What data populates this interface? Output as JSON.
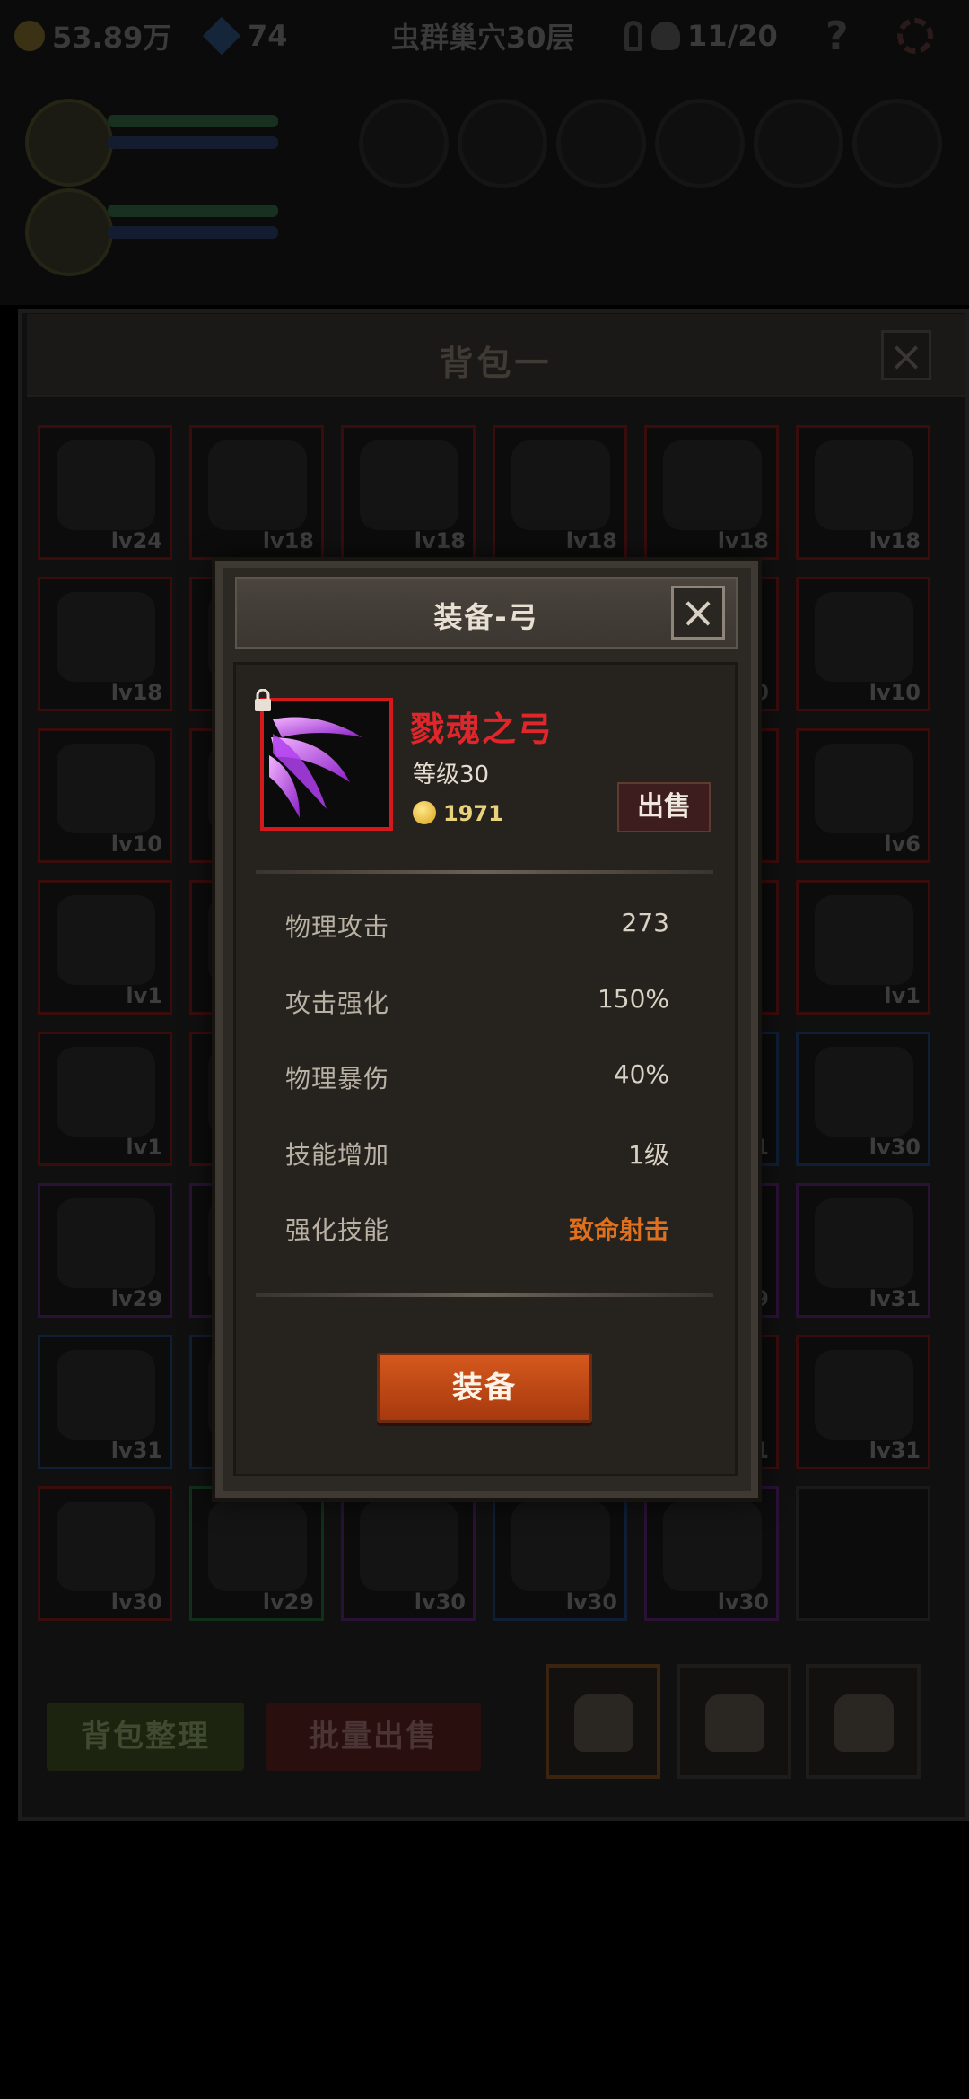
{
  "hud": {
    "gold": "53.89万",
    "gems": "74",
    "stage": "虫群巢穴30层",
    "lives": "11/20"
  },
  "backpack": {
    "title": "背包一",
    "items": [
      {
        "lv": "lv24",
        "rarity": "red"
      },
      {
        "lv": "lv18",
        "rarity": "red"
      },
      {
        "lv": "lv18",
        "rarity": "red"
      },
      {
        "lv": "lv18",
        "rarity": "red"
      },
      {
        "lv": "lv18",
        "rarity": "red"
      },
      {
        "lv": "lv18",
        "rarity": "red"
      },
      {
        "lv": "lv18",
        "rarity": "red"
      },
      {
        "lv": "",
        "rarity": "red"
      },
      {
        "lv": "",
        "rarity": "red"
      },
      {
        "lv": "",
        "rarity": "red"
      },
      {
        "lv": "lv10",
        "rarity": "red"
      },
      {
        "lv": "lv10",
        "rarity": "red"
      },
      {
        "lv": "lv10",
        "rarity": "red"
      },
      {
        "lv": "",
        "rarity": "red"
      },
      {
        "lv": "",
        "rarity": "red"
      },
      {
        "lv": "",
        "rarity": "red"
      },
      {
        "lv": "",
        "rarity": "red"
      },
      {
        "lv": "lv6",
        "rarity": "red"
      },
      {
        "lv": "lv1",
        "rarity": "red"
      },
      {
        "lv": "",
        "rarity": "red"
      },
      {
        "lv": "",
        "rarity": "red"
      },
      {
        "lv": "",
        "rarity": "red"
      },
      {
        "lv": "",
        "rarity": "red"
      },
      {
        "lv": "lv1",
        "rarity": "red"
      },
      {
        "lv": "lv1",
        "rarity": "red"
      },
      {
        "lv": "",
        "rarity": "red"
      },
      {
        "lv": "",
        "rarity": "red"
      },
      {
        "lv": "",
        "rarity": "red"
      },
      {
        "lv": "1",
        "rarity": "blue"
      },
      {
        "lv": "lv30",
        "rarity": "blue"
      },
      {
        "lv": "lv29",
        "rarity": "purple"
      },
      {
        "lv": "",
        "rarity": "purple"
      },
      {
        "lv": "",
        "rarity": "purple"
      },
      {
        "lv": "",
        "rarity": "purple"
      },
      {
        "lv": "9",
        "rarity": "purple"
      },
      {
        "lv": "lv31",
        "rarity": "purple"
      },
      {
        "lv": "lv31",
        "rarity": "blue"
      },
      {
        "lv": "",
        "rarity": "blue"
      },
      {
        "lv": "",
        "rarity": "blue"
      },
      {
        "lv": "",
        "rarity": "blue"
      },
      {
        "lv": "1",
        "rarity": "red"
      },
      {
        "lv": "lv31",
        "rarity": "red"
      },
      {
        "lv": "lv30",
        "rarity": "red"
      },
      {
        "lv": "lv29",
        "rarity": "green"
      },
      {
        "lv": "lv30",
        "rarity": "purple"
      },
      {
        "lv": "lv30",
        "rarity": "blue"
      },
      {
        "lv": "lv30",
        "rarity": "purple"
      },
      {
        "lv": "",
        "rarity": "none"
      }
    ],
    "sort_label": "背包整理",
    "bulk_sell_label": "批量出售"
  },
  "dialog": {
    "title": "装备-弓",
    "item_name": "戮魂之弓",
    "item_level": "等级30",
    "price": "1971",
    "sell_label": "出售",
    "stats": [
      {
        "label": "物理攻击",
        "value": "273",
        "highlight": false
      },
      {
        "label": "攻击强化",
        "value": "150%",
        "highlight": false
      },
      {
        "label": "物理暴伤",
        "value": "40%",
        "highlight": false
      },
      {
        "label": "技能增加",
        "value": "1级",
        "highlight": false
      },
      {
        "label": "强化技能",
        "value": "致命射击",
        "highlight": true
      }
    ],
    "equip_label": "装备"
  },
  "colors": {
    "name_red": "#e0262b",
    "skill_orange": "#e0701c",
    "equip_orange": "#c84b17"
  }
}
